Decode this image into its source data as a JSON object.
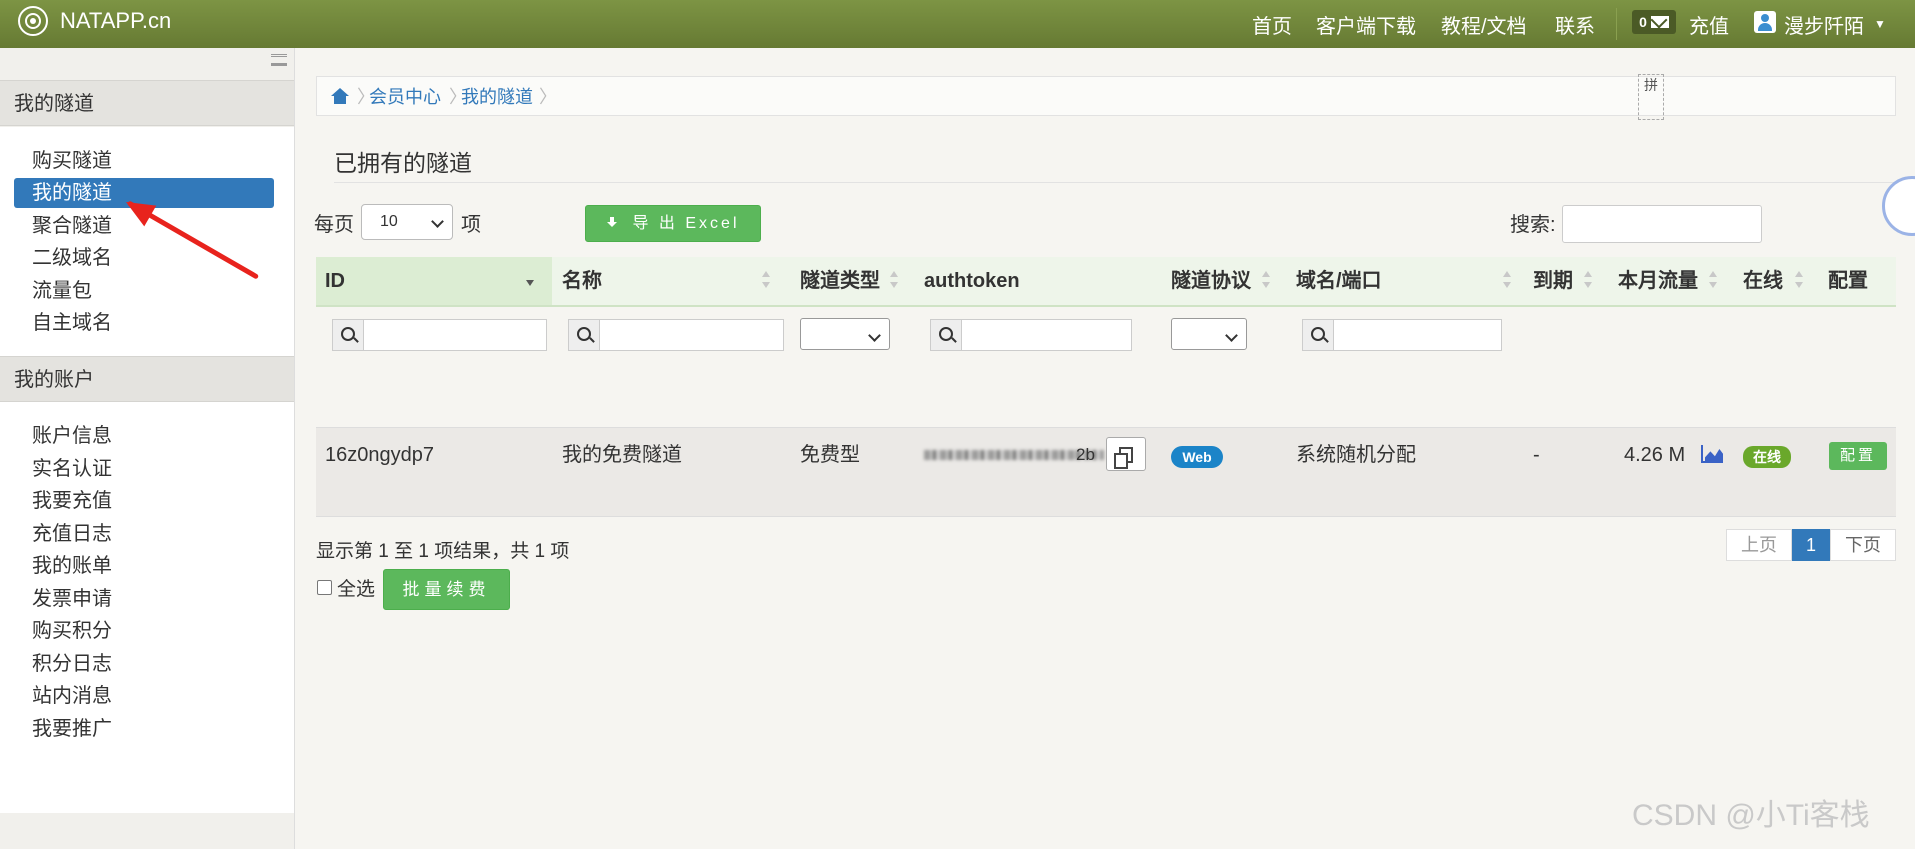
{
  "brand": {
    "name": "NATAPP.cn"
  },
  "topnav": {
    "items": [
      "首页",
      "客户端下载",
      "教程/文档",
      "联系"
    ],
    "message_count": "0",
    "recharge": "充值",
    "username": "漫步阡陌"
  },
  "sidebar": {
    "section1": {
      "title": "我的隧道",
      "items": [
        "购买隧道",
        "我的隧道",
        "聚合隧道",
        "二级域名",
        "流量包",
        "自主域名"
      ],
      "active_index": 1
    },
    "section2": {
      "title": "我的账户",
      "items": [
        "账户信息",
        "实名认证",
        "我要充值",
        "充值日志",
        "我的账单",
        "发票申请",
        "购买积分",
        "积分日志",
        "站内消息",
        "我要推广"
      ]
    }
  },
  "breadcrumb": {
    "items": [
      "会员中心",
      "我的隧道"
    ]
  },
  "ime_icon": "拼",
  "page_title": "已拥有的隧道",
  "controls": {
    "per_page_prefix": "每页",
    "per_page_value": "10",
    "per_page_suffix": "项",
    "export_label": "导 出  Excel",
    "search_label": "搜索:"
  },
  "table": {
    "headers": [
      "ID",
      "名称",
      "隧道类型",
      "authtoken",
      "隧道协议",
      "域名/端口",
      "到期",
      "本月流量",
      "在线",
      "配置"
    ],
    "rows": [
      {
        "id": "16z0ngydp7",
        "name": "我的免费隧道",
        "type": "免费型",
        "authtoken_tail": "2b",
        "protocol": "Web",
        "domain": "系统随机分配",
        "expire": "-",
        "traffic": "4.26 M",
        "online": "在线",
        "config": "配置"
      }
    ]
  },
  "footer": {
    "result_text": "显示第 1 至 1 项结果，共 1 项",
    "select_all": "全选",
    "batch_renew": "批量续费",
    "pager": {
      "prev": "上页",
      "current": "1",
      "next": "下页"
    }
  },
  "watermark": "CSDN @小Ti客栈",
  "colors": {
    "topbar": "#71873b",
    "primary": "#3279ba",
    "success": "#5cb85c",
    "annotation": "#e8231d"
  }
}
